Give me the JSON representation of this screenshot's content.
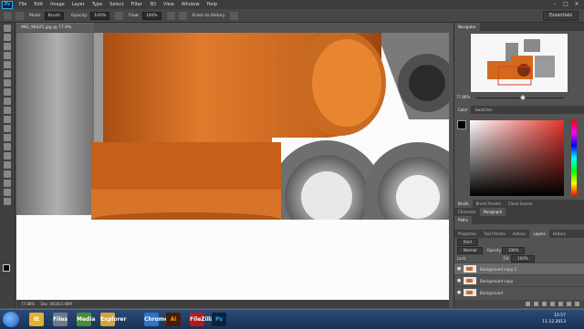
{
  "app": {
    "logo": "Ps",
    "menu": [
      "File",
      "Edit",
      "Image",
      "Layer",
      "Type",
      "Select",
      "Filter",
      "3D",
      "View",
      "Window",
      "Help"
    ],
    "window_controls": [
      "–",
      "□",
      "✕"
    ]
  },
  "options_bar": {
    "mode_label": "Mode:",
    "mode_value": "Brush",
    "opacity_label": "Opacity:",
    "opacity_value": "100%",
    "flow_label": "Flow:",
    "flow_value": "100%",
    "history_label": "Erase to History",
    "workspace": "Essentials"
  },
  "document": {
    "tab_title": "IMG_96025.jpg @ 77.9% (Background copy 2, RGB/8)",
    "tab_close": "×",
    "zoom": "77.88%",
    "doc_info": "Doc: 861K/3.46M"
  },
  "navigator": {
    "tabs": [
      "Navigator"
    ],
    "zoom": "77.88%"
  },
  "color_panel": {
    "tabs": [
      "Color",
      "Swatches"
    ]
  },
  "brush_panel": {
    "tabs": [
      "Brush",
      "Brush Presets",
      "Clone Source"
    ]
  },
  "char_panel": {
    "tabs": [
      "Character",
      "Paragraph"
    ]
  },
  "paths_panel": {
    "tabs": [
      "Paths"
    ]
  },
  "layers_panel": {
    "tabs": [
      "Properties",
      "Tool Presets",
      "Actions",
      "Layers",
      "History"
    ],
    "kind_label": "Kind",
    "blend_mode": "Normal",
    "opacity_label": "Opacity:",
    "opacity_value": "100%",
    "lock_label": "Lock:",
    "fill_label": "Fill:",
    "fill_value": "100%",
    "layers": [
      {
        "name": "Background copy 2",
        "selected": true
      },
      {
        "name": "Background copy",
        "selected": false
      },
      {
        "name": "Background",
        "selected": false
      }
    ]
  },
  "taskbar": {
    "apps": [
      "IE",
      "Files",
      "Media",
      "Explorer",
      "Chrome",
      "Ai",
      "FileZilla",
      "Ps"
    ],
    "time": "12:57",
    "date": "11.12.2013"
  },
  "colors": {
    "pipe_orange": "#d2691e",
    "pipe_gray": "#8a8a8a",
    "ps_blue": "#31a8ff"
  }
}
